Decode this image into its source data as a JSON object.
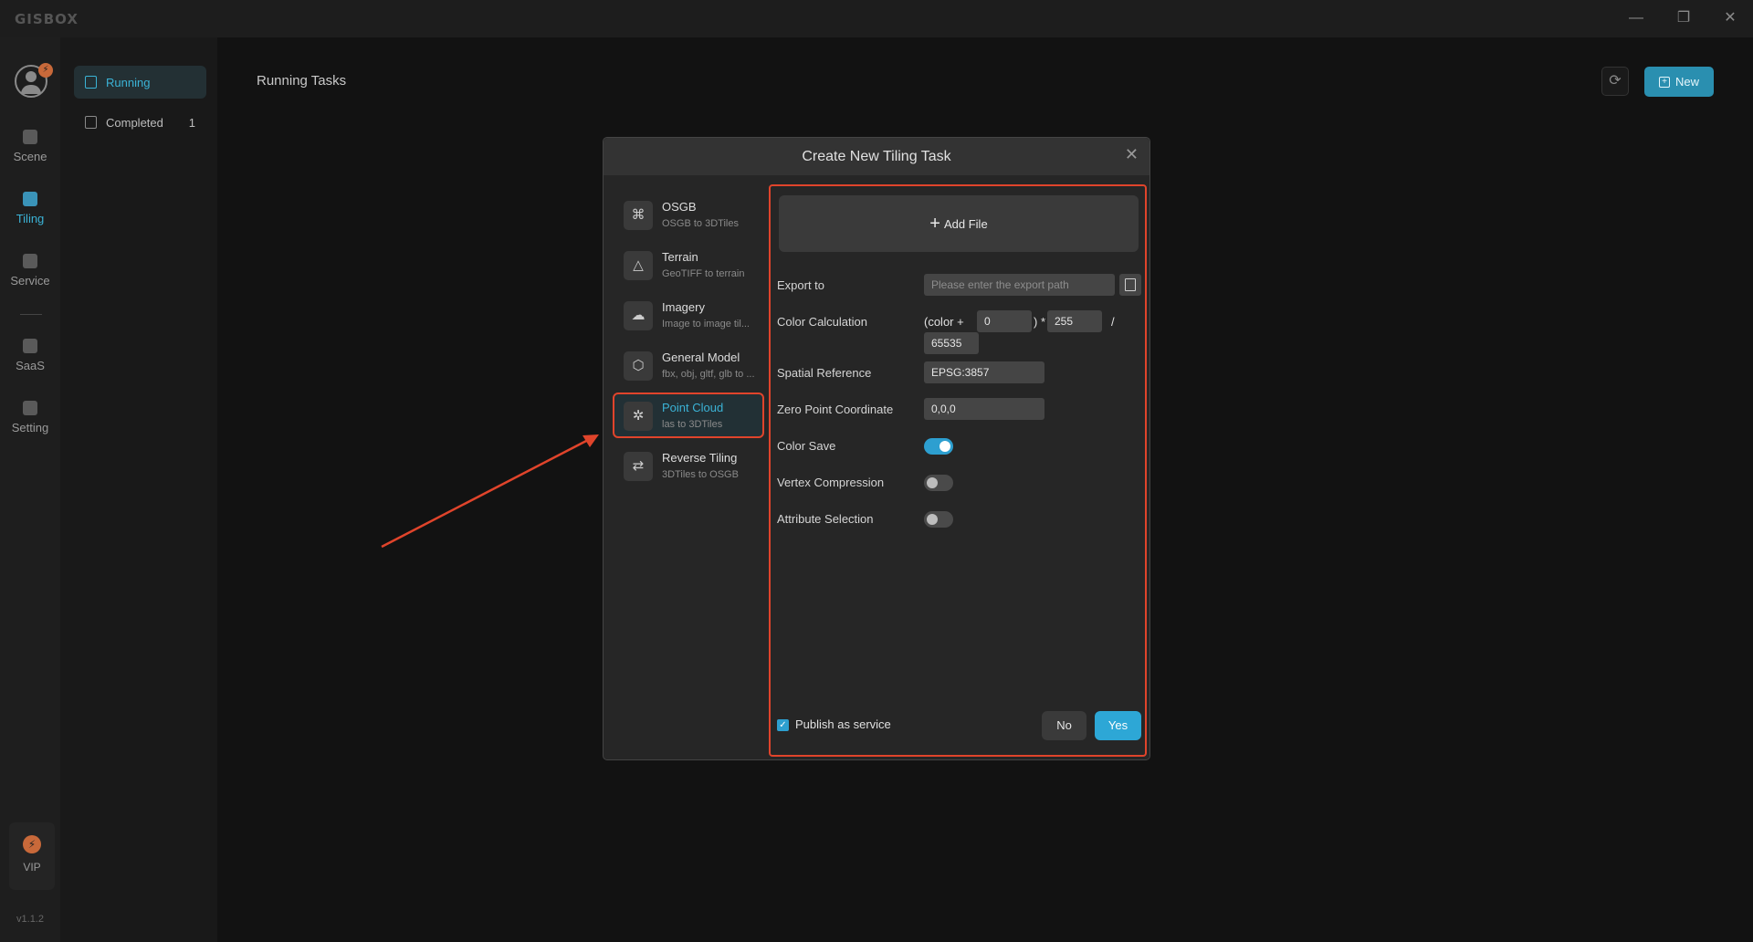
{
  "app": {
    "logo_text": "GISBOX",
    "window_controls": {
      "minimize": "—",
      "restore": "❐",
      "close": "✕"
    }
  },
  "rail": {
    "avatar_badge": "⚡",
    "items": [
      {
        "label": "Scene",
        "icon": "home-icon"
      },
      {
        "label": "Tiling",
        "icon": "tiling-icon",
        "active": true
      },
      {
        "label": "Service",
        "icon": "service-icon"
      },
      {
        "label": "SaaS",
        "icon": "saas-icon"
      },
      {
        "label": "Setting",
        "icon": "settings-icon"
      }
    ],
    "vip": {
      "icon": "⚡",
      "label": "VIP"
    },
    "version": "v1.1.2"
  },
  "subnav": {
    "items": [
      {
        "label": "Running",
        "active": true
      },
      {
        "label": "Completed",
        "count": "1"
      }
    ]
  },
  "header": {
    "title": "Running Tasks",
    "refresh_icon": "⟳",
    "new_label": "New"
  },
  "modal": {
    "title": "Create New Tiling Task",
    "close": "✕",
    "task_types": [
      {
        "name": "OSGB",
        "desc": "OSGB to 3DTiles",
        "icon": "⌘"
      },
      {
        "name": "Terrain",
        "desc": "GeoTIFF to terrain",
        "icon": "△"
      },
      {
        "name": "Imagery",
        "desc": "Image to image til...",
        "icon": "☁"
      },
      {
        "name": "General Model",
        "desc": "fbx, obj, gltf, glb to ...",
        "icon": "⬡"
      },
      {
        "name": "Point Cloud",
        "desc": "las to 3DTiles",
        "icon": "✲",
        "active": true
      },
      {
        "name": "Reverse Tiling",
        "desc": "3DTiles to OSGB",
        "icon": "⇄"
      }
    ],
    "form": {
      "add_file_label": "Add File",
      "add_file_icon": "+",
      "export_label": "Export to",
      "export_placeholder": "Please enter the export path",
      "color_calc_label": "Color Calculation",
      "color_prefix": "(color +",
      "color_offset": "0",
      "color_mid": ") *",
      "color_multiplier": "255",
      "color_div": "/",
      "color_divisor": "65535",
      "spatial_ref_label": "Spatial Reference",
      "spatial_ref_value": "EPSG:3857",
      "zero_point_label": "Zero Point Coordinate",
      "zero_point_value": "0,0,0",
      "color_save_label": "Color Save",
      "color_save_on": true,
      "vertex_compression_label": "Vertex Compression",
      "vertex_compression_on": false,
      "attribute_selection_label": "Attribute Selection",
      "attribute_selection_on": false,
      "publish_label": "Publish as service",
      "publish_checked": true,
      "no_label": "No",
      "yes_label": "Yes"
    }
  },
  "colors": {
    "accent": "#2da7d6",
    "highlight_border": "#e0442b",
    "vip": "#c8693a"
  }
}
